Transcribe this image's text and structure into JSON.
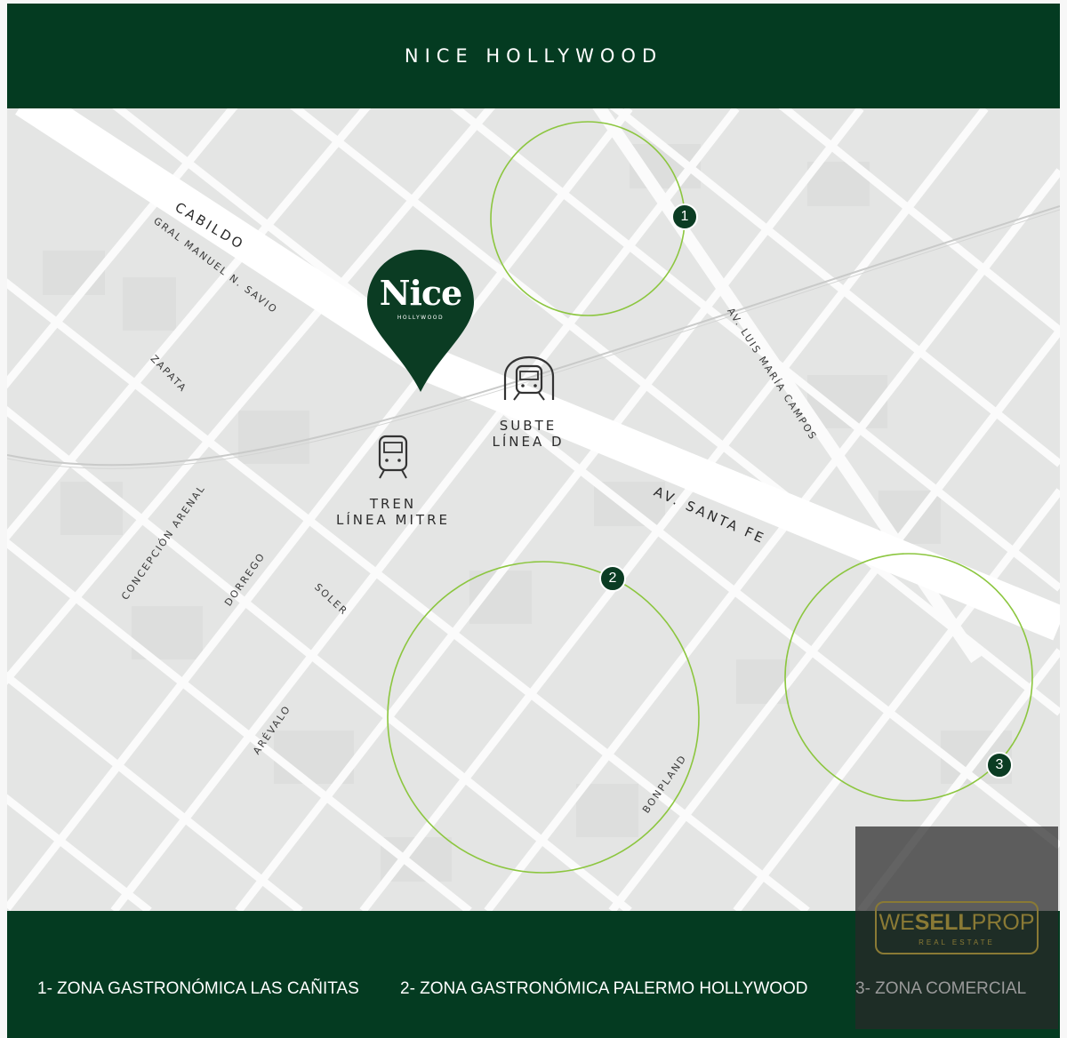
{
  "header": {
    "title": "NICE HOLLYWOOD"
  },
  "pin": {
    "name": "Nice",
    "sub": "HOLLYWOOD"
  },
  "streets": {
    "cabildo": "CABILDO",
    "savio": "GRAL MANUEL N. SAVIO",
    "zapata": "ZAPATA",
    "luis_maria_campos": "AV. LUIS MARÍA CAMPOS",
    "santa_fe": "AV. SANTA FE",
    "concepcion_arenal": "CONCEPCIÓN ARENAL",
    "dorrego": "DORREGO",
    "soler": "SOLER",
    "arevalo": "ARÉVALO",
    "bonpland": "BONPLAND"
  },
  "transit": {
    "subte": {
      "line1": "SUBTE",
      "line2": "LÍNEA D",
      "icon": "subway-icon"
    },
    "tren": {
      "line1": "TREN",
      "line2": "LÍNEA MITRE",
      "icon": "train-icon"
    }
  },
  "zones": [
    {
      "number": "1",
      "color": "#8cc63f"
    },
    {
      "number": "2",
      "color": "#8cc63f"
    },
    {
      "number": "3",
      "color": "#8cc63f"
    }
  ],
  "legend": [
    "1- ZONA GASTRONÓMICA LAS CAÑITAS",
    "2- ZONA GASTRONÓMICA PALERMO HOLLYWOOD",
    "3- ZONA COMERCIAL"
  ],
  "watermark": {
    "brand_light": "WE",
    "brand_bold": "SELL",
    "brand_end": "PROP",
    "sub": "REAL ESTATE"
  },
  "colors": {
    "brand_green": "#043b21",
    "zone_circle": "#8cc63f",
    "map_bg": "#e6e7e6"
  }
}
